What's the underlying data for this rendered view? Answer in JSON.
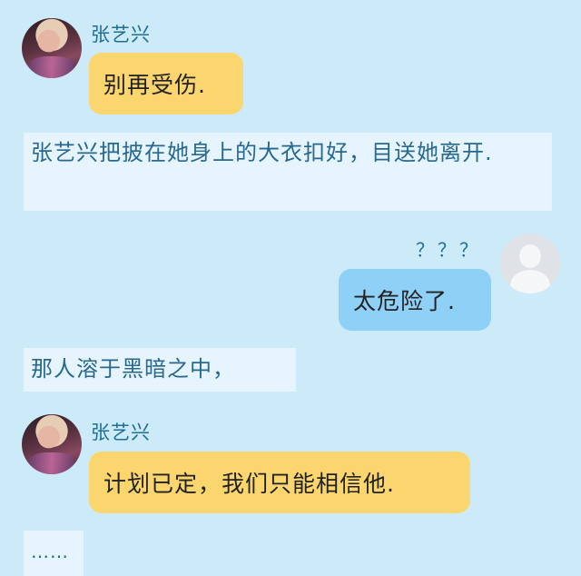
{
  "messages": {
    "m1": {
      "speaker": "张艺兴",
      "text": "别再受伤."
    },
    "n1": {
      "text": "张艺兴把披在她身上的大衣扣好，目送她离开."
    },
    "m2": {
      "speaker": "？？？",
      "text": "太危险了."
    },
    "n2": {
      "text": "那人溶于黑暗之中，"
    },
    "m3": {
      "speaker": "张艺兴",
      "text": "计划已定，我们只能相信他."
    },
    "n3": {
      "text": "……"
    }
  },
  "colors": {
    "background": "#cdeaf9",
    "bubble_left": "#fbd66e",
    "bubble_right": "#8fd0f6",
    "narration_bg": "#e6f5fd",
    "name_text": "#1f6f93"
  }
}
